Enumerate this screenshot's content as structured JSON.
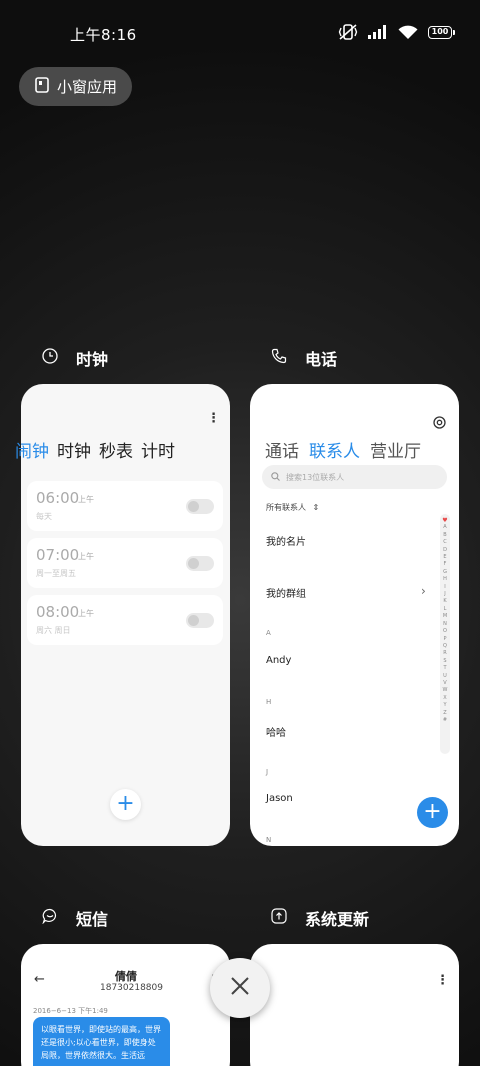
{
  "status_bar": {
    "time": "上午8:16",
    "battery": "100",
    "icons": [
      "mute-vibrate-icon",
      "signal-icon",
      "wifi-icon",
      "battery-icon"
    ]
  },
  "floating_window": {
    "label": "小窗应用",
    "icon": "floating-window-icon"
  },
  "cards": {
    "clock": {
      "app_name": "时钟",
      "icon": "clock-icon",
      "tabs": [
        "闹钟",
        "时钟",
        "秒表",
        "计时"
      ],
      "active_tab": 0,
      "alarms": [
        {
          "time": "06:00",
          "ampm": "上午",
          "repeat": "每天",
          "enabled": false
        },
        {
          "time": "07:00",
          "ampm": "上午",
          "repeat": "周一至周五",
          "enabled": false
        },
        {
          "time": "08:00",
          "ampm": "上午",
          "repeat": "周六 周日",
          "enabled": false
        }
      ],
      "add_label": "+"
    },
    "phone": {
      "app_name": "电话",
      "icon": "phone-icon",
      "tabs": [
        "通话",
        "联系人",
        "营业厅"
      ],
      "active_tab": 1,
      "search_placeholder": "搜索13位联系人",
      "filter_label": "所有联系人",
      "my_card": "我的名片",
      "my_groups": "我的群组",
      "sections": [
        {
          "letter": "A",
          "contact": "Andy"
        },
        {
          "letter": "H",
          "contact": "哈哈"
        },
        {
          "letter": "J",
          "contact": "Jason"
        },
        {
          "letter": "N",
          "contact": ""
        }
      ],
      "index_letters": [
        "♥",
        "A",
        "B",
        "C",
        "D",
        "E",
        "F",
        "G",
        "H",
        "I",
        "J",
        "K",
        "L",
        "M",
        "N",
        "O",
        "P",
        "Q",
        "R",
        "S",
        "T",
        "U",
        "V",
        "W",
        "X",
        "Y",
        "Z",
        "#"
      ],
      "add_label": "+"
    },
    "sms": {
      "app_name": "短信",
      "icon": "message-icon",
      "contact_name": "倩倩",
      "contact_number": "18730218809",
      "date": "2016−6−13 下午1:49",
      "message": "以眼看世界，即使站的最高，世界还是很小;以心看世界，即使身处局限，世界依然很大。生活远"
    },
    "update": {
      "app_name": "系统更新",
      "icon": "system-update-icon"
    }
  },
  "close_button": {
    "icon": "close-icon"
  },
  "colors": {
    "accent": "#2a8ce8",
    "background": "#111111",
    "card": "#ffffff"
  }
}
